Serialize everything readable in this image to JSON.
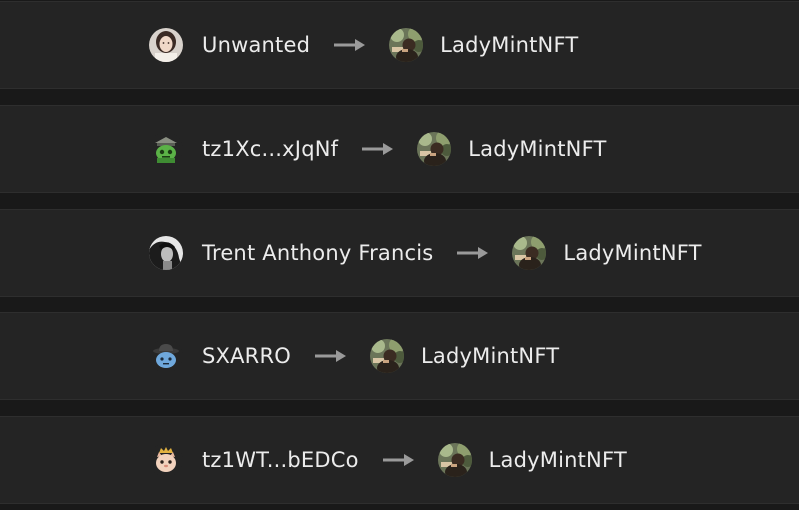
{
  "colors": {
    "background": "#191919",
    "row": "#242424",
    "text": "#ececec",
    "arrow": "#9a9a9a"
  },
  "transfers": [
    {
      "from": {
        "name": "Unwanted",
        "avatar": "avatar-woman-photo"
      },
      "to": {
        "name": "LadyMintNFT",
        "avatar": "avatar-ladymint-photo"
      }
    },
    {
      "from": {
        "name": "tz1Xc...xJqNf",
        "avatar": "avatar-green-monster"
      },
      "to": {
        "name": "LadyMintNFT",
        "avatar": "avatar-ladymint-photo"
      }
    },
    {
      "from": {
        "name": "Trent Anthony Francis",
        "avatar": "avatar-bw-portrait"
      },
      "to": {
        "name": "LadyMintNFT",
        "avatar": "avatar-ladymint-photo"
      }
    },
    {
      "from": {
        "name": "SXARRO",
        "avatar": "avatar-blue-character-hat"
      },
      "to": {
        "name": "LadyMintNFT",
        "avatar": "avatar-ladymint-photo"
      }
    },
    {
      "from": {
        "name": "tz1WT...bEDCo",
        "avatar": "avatar-cat-crown"
      },
      "to": {
        "name": "LadyMintNFT",
        "avatar": "avatar-ladymint-photo"
      }
    }
  ]
}
